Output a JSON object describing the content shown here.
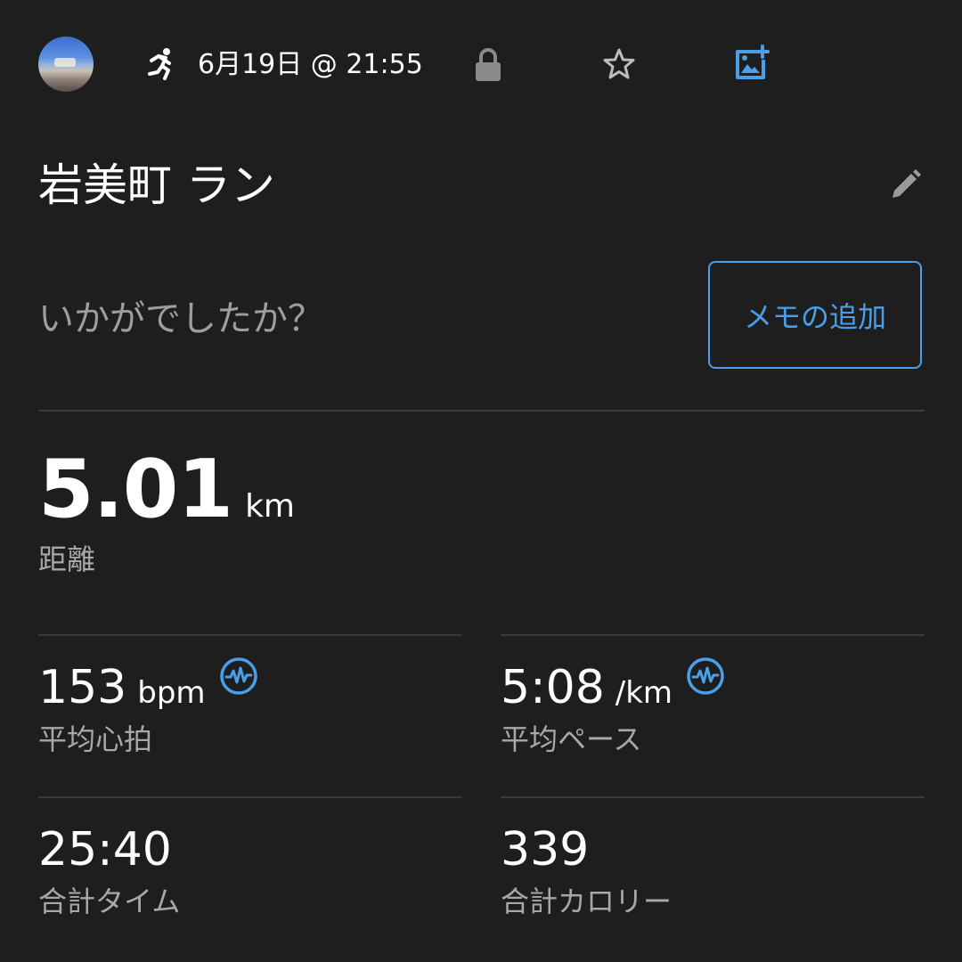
{
  "header": {
    "activity_icon": "running-person-icon",
    "datetime": "6月19日 @ 21:55",
    "privacy_icon": "lock-icon",
    "favorite_icon": "star-outline-icon",
    "add_photo_icon": "add-photo-icon"
  },
  "activity": {
    "title": "岩美町 ラン",
    "edit_icon": "pencil-icon",
    "prompt": "いかがでしたか？",
    "add_note_label": "メモの追加"
  },
  "distance": {
    "value": "5.01",
    "unit": "km",
    "label": "距離"
  },
  "stats": [
    {
      "value": "153",
      "unit": "bpm",
      "label": "平均心拍",
      "icon": "heart-rate-pulse-icon"
    },
    {
      "value": "5:08",
      "unit": "/km",
      "label": "平均ペース",
      "icon": "heart-rate-pulse-icon"
    },
    {
      "value": "25:40",
      "unit": "",
      "label": "合計タイム"
    },
    {
      "value": "339",
      "unit": "",
      "label": "合計カロリー"
    }
  ],
  "colors": {
    "background": "#1e1e1e",
    "accent": "#4a9fea",
    "text_primary": "#ffffff",
    "text_secondary": "#a8a8a8",
    "divider": "#3a3a3a"
  }
}
